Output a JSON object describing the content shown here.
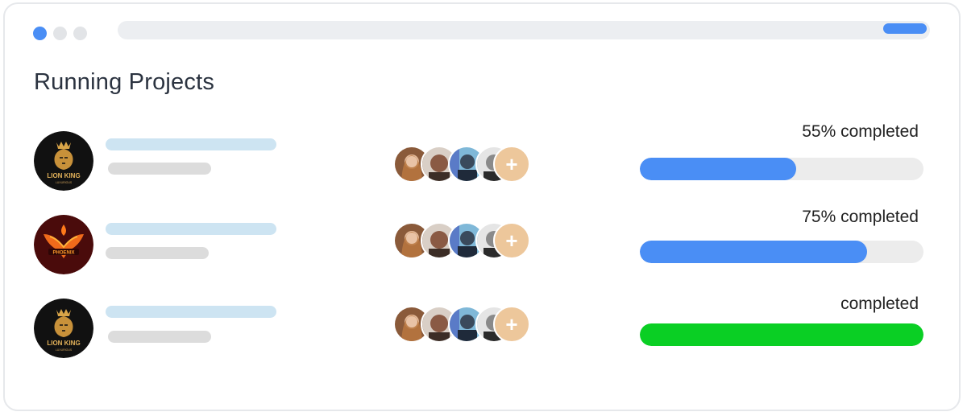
{
  "window": {
    "controls": [
      "close",
      "minimize",
      "maximize"
    ],
    "accent": "#4a8ef5"
  },
  "page": {
    "title": "Running Projects"
  },
  "projects": [
    {
      "logo": "lion-king-logo",
      "logo_text": "LION KING",
      "logo_subtext": "LUXURIOUS",
      "members": [
        "avatar-woman-1",
        "avatar-man-1",
        "avatar-man-2",
        "avatar-man-3"
      ],
      "add_label": "+",
      "status": "55% completed",
      "progress": 0.55,
      "bar_color": "#4a8ef5"
    },
    {
      "logo": "phoenix-logo",
      "logo_text": "PHOENIX",
      "logo_subtext": "",
      "members": [
        "avatar-woman-1",
        "avatar-man-1",
        "avatar-man-2",
        "avatar-man-3"
      ],
      "add_label": "+",
      "status": "75% completed",
      "progress": 0.8,
      "bar_color": "#4a8ef5"
    },
    {
      "logo": "lion-king-logo",
      "logo_text": "LION KING",
      "logo_subtext": "LUXURIOUS",
      "members": [
        "avatar-woman-1",
        "avatar-man-1",
        "avatar-man-2",
        "avatar-man-3"
      ],
      "add_label": "+",
      "status": "completed",
      "progress": 1.0,
      "bar_color": "#0acf24"
    }
  ]
}
